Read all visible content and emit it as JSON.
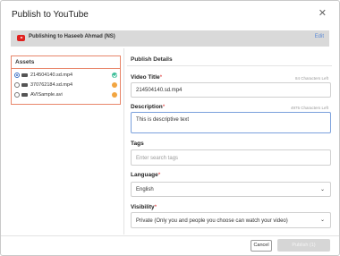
{
  "dialog": {
    "title": "Publish to YouTube",
    "close_glyph": "✕"
  },
  "channel": {
    "icon": "youtube-icon",
    "text": "Publishing to Haseeb Ahmad (NS)",
    "edit_label": "Edit",
    "bar_color": "#d9d9d9"
  },
  "assets": {
    "title": "Assets",
    "items": [
      {
        "name": "214504140.sd.mp4",
        "selected": true,
        "status": "ok"
      },
      {
        "name": "370762184.sd.mp4",
        "selected": false,
        "status": "warn"
      },
      {
        "name": "AVISample.avi",
        "selected": false,
        "status": "warn"
      }
    ],
    "border_color": "#e8866a"
  },
  "details": {
    "title": "Publish Details",
    "video_title": {
      "label": "Video Title",
      "required": "*",
      "counter": "84 Characters Left",
      "value": "214504140.sd.mp4"
    },
    "description": {
      "label": "Description",
      "required": "*",
      "counter": "4975 Characters Left",
      "value": "This is descriptive text"
    },
    "tags": {
      "label": "Tags",
      "placeholder": "Enter search tags"
    },
    "language": {
      "label": "Language",
      "required": "*",
      "value": "English"
    },
    "visibility": {
      "label": "Visibility",
      "required": "*",
      "value": "Private (Only you and people you choose can watch your video)"
    }
  },
  "footer": {
    "cancel_label": "Cancel",
    "publish_label": "Publish (1)"
  }
}
